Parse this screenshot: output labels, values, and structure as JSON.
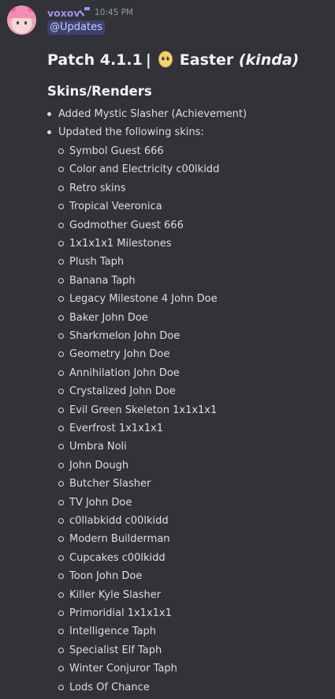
{
  "message": {
    "author": "voxov",
    "timestamp": "10:45 PM",
    "mention": "@Updates",
    "title": {
      "prefix": "Patch 4.1.1",
      "separator": "|",
      "emoji": "egg-emoji",
      "word": "Easter",
      "suffix": "(kinda)"
    },
    "section_heading": "Skins/Renders",
    "bullets": [
      "Added Mystic Slasher (Achievement)",
      "Updated the following skins:"
    ],
    "skins": [
      "Symbol Guest 666",
      "Color and Electricity c00lkidd",
      "Retro skins",
      "Tropical Veeronica",
      "Godmother Guest 666",
      "1x1x1x1 Milestones",
      "Plush Taph",
      "Banana Taph",
      "Legacy Milestone 4 John Doe",
      "Baker John Doe",
      "Sharkmelon John Doe",
      "Geometry John Doe",
      "Annihilation John Doe",
      "Crystalized John Doe",
      "Evil Green Skeleton 1x1x1x1",
      "Everfrost 1x1x1x1",
      "Umbra Noli",
      "John Dough",
      "Butcher Slasher",
      "TV John Doe",
      "c0llabkidd c00lkidd",
      "Modern Builderman",
      "Cupcakes c00lkidd",
      "Toon John Doe",
      "Killer Kyle Slasher",
      "Primoridial 1x1x1x1",
      "Intelligence Taph",
      "Specialist Elf Taph",
      "Winter Conjuror Taph",
      "Lods Of Chance"
    ]
  },
  "colors": {
    "background": "#323339",
    "username": "#a58cf0",
    "mention_bg": "#3c4270",
    "mention_text": "#c9cdfb",
    "text": "#dbdee1",
    "heading": "#f2f3f5"
  }
}
